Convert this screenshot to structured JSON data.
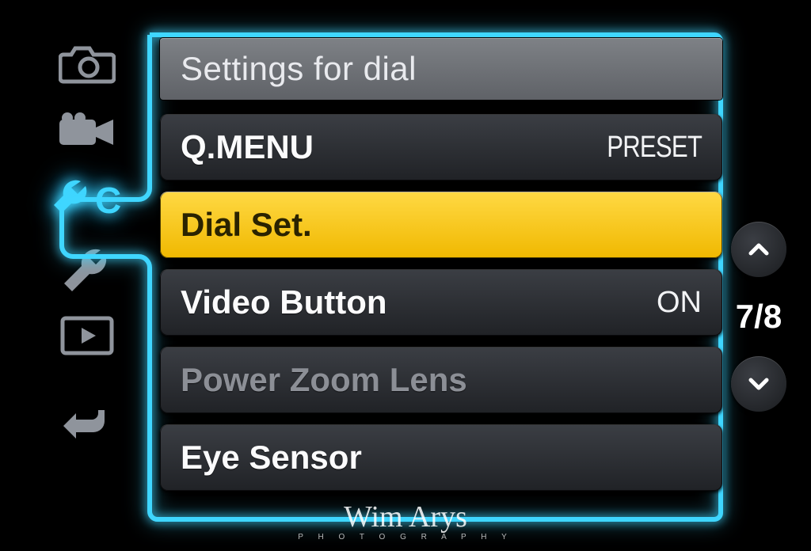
{
  "header": {
    "title": "Settings for dial"
  },
  "rows": [
    {
      "label": "Q.MENU",
      "value": "PRESET"
    },
    {
      "label": "Dial Set.",
      "value": ""
    },
    {
      "label": "Video Button",
      "value": "ON"
    },
    {
      "label": "Power Zoom Lens",
      "value": ""
    },
    {
      "label": "Eye Sensor",
      "value": ""
    }
  ],
  "pager": {
    "page": "7/8"
  },
  "watermark": {
    "name": "Wim Arys",
    "sub": "P H O T O G R A P H Y"
  },
  "icons": {
    "camera": "camera-icon",
    "video": "video-camera-icon",
    "custom": "wrench-c-icon",
    "setup": "wrench-icon",
    "playback": "playback-icon",
    "back": "back-arrow-icon"
  }
}
